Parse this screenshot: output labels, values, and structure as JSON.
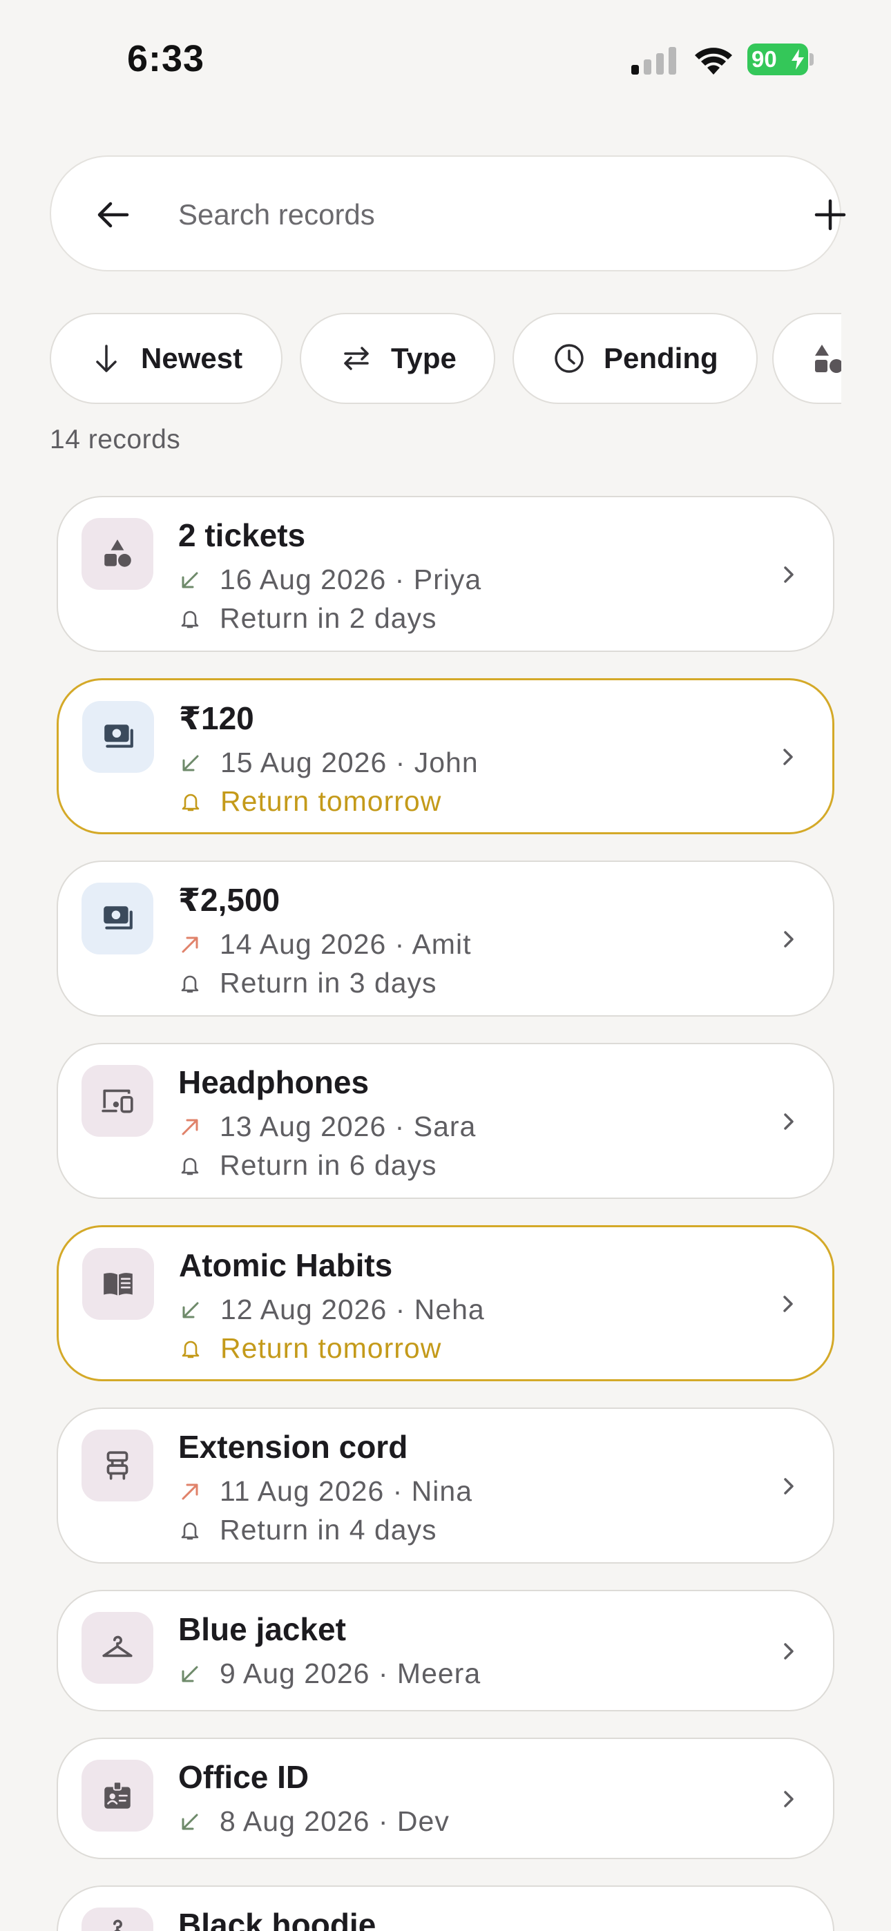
{
  "status_bar": {
    "time": "6:33",
    "battery": "90"
  },
  "search": {
    "placeholder": "Search records"
  },
  "filters": [
    {
      "label": "Newest",
      "icon": "arrow-down-icon"
    },
    {
      "label": "Type",
      "icon": "swap-icon"
    },
    {
      "label": "Pending",
      "icon": "clock-icon"
    },
    {
      "label": "",
      "icon": "category-icon"
    }
  ],
  "record_count": "14 records",
  "colors": {
    "accent_due": "#d4a928",
    "lent": "#e0826a",
    "borrowed": "#6e8a6a"
  },
  "records": [
    {
      "title": "2 tickets",
      "direction": "borrowed",
      "date": "16 Aug 2026",
      "person": "Priya",
      "meta": "16 Aug 2026 · Priya",
      "reminder": "Return in 2 days",
      "due": false,
      "icon": "shapes-icon"
    },
    {
      "title": "₹120",
      "direction": "borrowed",
      "date": "15 Aug 2026",
      "person": "John",
      "meta": "15 Aug 2026 · John",
      "reminder": "Return tomorrow",
      "due": true,
      "icon": "money-icon"
    },
    {
      "title": "₹2,500",
      "direction": "lent",
      "date": "14 Aug 2026",
      "person": "Amit",
      "meta": "14 Aug 2026 · Amit",
      "reminder": "Return in 3 days",
      "due": false,
      "icon": "money-icon"
    },
    {
      "title": "Headphones",
      "direction": "lent",
      "date": "13 Aug 2026",
      "person": "Sara",
      "meta": "13 Aug 2026 · Sara",
      "reminder": "Return in 6 days",
      "due": false,
      "icon": "devices-icon"
    },
    {
      "title": "Atomic Habits",
      "direction": "borrowed",
      "date": "12 Aug 2026",
      "person": "Neha",
      "meta": "12 Aug 2026 · Neha",
      "reminder": "Return tomorrow",
      "due": true,
      "icon": "book-icon"
    },
    {
      "title": "Extension cord",
      "direction": "lent",
      "date": "11 Aug 2026",
      "person": "Nina",
      "meta": "11 Aug 2026 · Nina",
      "reminder": "Return in 4 days",
      "due": false,
      "icon": "appliance-icon"
    },
    {
      "title": "Blue jacket",
      "direction": "borrowed",
      "date": "9 Aug 2026",
      "person": "Meera",
      "meta": "9 Aug 2026 · Meera",
      "reminder": "",
      "due": false,
      "icon": "hanger-icon"
    },
    {
      "title": "Office ID",
      "direction": "borrowed",
      "date": "8 Aug 2026",
      "person": "Dev",
      "meta": "8 Aug 2026 · Dev",
      "reminder": "",
      "due": false,
      "icon": "badge-icon"
    },
    {
      "title": "Black hoodie",
      "direction": "",
      "date": "",
      "person": "",
      "meta": "",
      "reminder": "",
      "due": false,
      "icon": "hanger-icon"
    }
  ]
}
